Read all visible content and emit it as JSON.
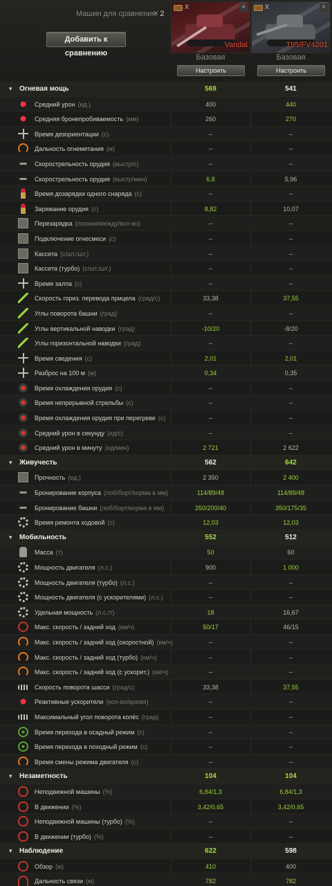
{
  "header": {
    "compare_label": "Машин для сравнения:",
    "compare_count": "2",
    "clear_glyph": "×",
    "add_button": "Добавить к сравнению"
  },
  "vehicles": [
    {
      "name": "Vandal",
      "config": "Базовая",
      "setup": "Настроить",
      "close": "×",
      "mark": "X"
    },
    {
      "name": "T95/FV4201",
      "config": "Базовая",
      "setup": "Настроить",
      "close": "×",
      "mark": "X"
    }
  ],
  "colors": {
    "better": "#9bd43b",
    "name": "#e8533a",
    "bg": "#1b1b19"
  },
  "rows": [
    {
      "type": "section",
      "label": "Огневая мощь",
      "v1": "569",
      "v2": "541",
      "g1": true,
      "g2": false
    },
    {
      "icon": "ic-fire",
      "icon_name": "damage-icon",
      "label": "Средний урон",
      "unit": "(ед.)",
      "v1": "400",
      "v2": "440",
      "g1": false,
      "g2": true
    },
    {
      "icon": "ic-fire",
      "icon_name": "penetration-icon",
      "label": "Средняя бронепробиваемость",
      "unit": "(мм)",
      "v1": "260",
      "v2": "270",
      "g1": false,
      "g2": true
    },
    {
      "icon": "ic-cross",
      "icon_name": "stun-time-icon",
      "label": "Время дезориентации",
      "unit": "(с)",
      "v1": "--",
      "v2": "--"
    },
    {
      "icon": "ic-gauge",
      "icon_name": "flamethrower-range-icon",
      "label": "Дальность огнеметания",
      "unit": "(м)",
      "v1": "--",
      "v2": "--"
    },
    {
      "icon": "ic-gun",
      "icon_name": "fire-rate-icon",
      "label": "Скорострельность орудия",
      "unit": "(выстр/с)",
      "v1": "--",
      "v2": "--"
    },
    {
      "icon": "ic-gun",
      "icon_name": "fire-rate-min-icon",
      "label": "Скорострельность орудия",
      "unit": "(выстр/мин)",
      "v1": "6,8",
      "v2": "5,96",
      "g1": true,
      "g2": false
    },
    {
      "icon": "ic-shell",
      "icon_name": "shell-reload-icon",
      "label": "Время дозарядки одного снаряда",
      "unit": "(с)",
      "v1": "--",
      "v2": "--"
    },
    {
      "icon": "ic-shell",
      "icon_name": "reload-icon",
      "label": "Заряжание орудия",
      "unit": "(с)",
      "v1": "8,82",
      "v2": "10,07",
      "g1": true,
      "g2": false
    },
    {
      "icon": "ic-box",
      "icon_name": "autoreload-icon",
      "label": "Перезарядка",
      "unit": "(полная/между/кол-во)",
      "v1": "--",
      "v2": "--"
    },
    {
      "icon": "ic-box",
      "icon_name": "flame-mix-icon",
      "label": "Подключение огнесмеси",
      "unit": "(с)",
      "v1": "--",
      "v2": "--"
    },
    {
      "icon": "ic-box",
      "icon_name": "clip-icon",
      "label": "Кассета",
      "unit": "(с/шт./шт.)",
      "v1": "--",
      "v2": "--"
    },
    {
      "icon": "ic-box",
      "icon_name": "clip-turbo-icon",
      "label": "Кассета (турбо)",
      "unit": "(с/шт./шт.)",
      "v1": "--",
      "v2": "--"
    },
    {
      "icon": "ic-cross",
      "icon_name": "salvo-time-icon",
      "label": "Время залпа",
      "unit": "(с)",
      "v1": "--",
      "v2": "--"
    },
    {
      "icon": "ic-arrow",
      "icon_name": "traverse-speed-icon",
      "label": "Скорость гориз. перевода прицела",
      "unit": "(град/с)",
      "v1": "33,38",
      "v2": "37,55",
      "g1": false,
      "g2": true
    },
    {
      "icon": "ic-arrow",
      "icon_name": "turret-angles-icon",
      "label": "Углы поворота башни",
      "unit": "(град)",
      "v1": "--",
      "v2": "--"
    },
    {
      "icon": "ic-arrow",
      "icon_name": "vertical-angles-icon",
      "label": "Углы вертикальной наводки",
      "unit": "(град)",
      "v1": "-10/20",
      "v2": "-8/20",
      "g1": true,
      "g2": false
    },
    {
      "icon": "ic-arrow",
      "icon_name": "horizontal-angles-icon",
      "label": "Углы горизонтальной наводки",
      "unit": "(град)",
      "v1": "--",
      "v2": "--"
    },
    {
      "icon": "ic-cross",
      "icon_name": "aim-time-icon",
      "label": "Время сведения",
      "unit": "(с)",
      "v1": "2,01",
      "v2": "2,01",
      "g1": true,
      "g2": true
    },
    {
      "icon": "ic-cross",
      "icon_name": "dispersion-icon",
      "label": "Разброс на 100 м",
      "unit": "(м)",
      "v1": "0,34",
      "v2": "0,35",
      "g1": true,
      "g2": false
    },
    {
      "icon": "ic-dot",
      "icon_name": "gun-cooling-icon",
      "label": "Время охлаждения орудия",
      "unit": "(с)",
      "v1": "--",
      "v2": "--"
    },
    {
      "icon": "ic-dot",
      "icon_name": "continuous-fire-icon",
      "label": "Время непрерывной стрельбы",
      "unit": "(с)",
      "v1": "--",
      "v2": "--"
    },
    {
      "icon": "ic-dot",
      "icon_name": "overheat-cooling-icon",
      "label": "Время охлаждения орудия при перегреве",
      "unit": "(с)",
      "v1": "--",
      "v2": "--"
    },
    {
      "icon": "ic-dot",
      "icon_name": "dps-icon",
      "label": "Средний урон в секунду",
      "unit": "(ед/с)",
      "v1": "--",
      "v2": "--"
    },
    {
      "icon": "ic-dot",
      "icon_name": "dpm-icon",
      "label": "Средний урон в минуту",
      "unit": "(ед/мин)",
      "v1": "2 721",
      "v2": "2 622",
      "g1": true,
      "g2": false
    },
    {
      "type": "section",
      "label": "Живучесть",
      "v1": "562",
      "v2": "642",
      "g1": false,
      "g2": true
    },
    {
      "icon": "ic-box",
      "icon_name": "hitpoints-icon",
      "label": "Прочность",
      "unit": "(ед.)",
      "v1": "2 350",
      "v2": "2 400",
      "g1": false,
      "g2": true
    },
    {
      "icon": "ic-gun",
      "icon_name": "hull-armor-icon",
      "label": "Бронирование корпуса",
      "unit": "(лоб/борт/корма в мм)",
      "v1": "114/89/48",
      "v2": "114/89/48",
      "g1": true,
      "g2": true
    },
    {
      "icon": "ic-gun",
      "icon_name": "turret-armor-icon",
      "label": "Бронирование башни",
      "unit": "(лоб/борт/корма в мм)",
      "v1": "250/200/40",
      "v2": "350/175/35",
      "g1": true,
      "g2": true
    },
    {
      "icon": "ic-gear",
      "icon_name": "repair-time-icon",
      "label": "Время ремонта ходовой",
      "unit": "(с)",
      "v1": "12,03",
      "v2": "12,03",
      "g1": true,
      "g2": true
    },
    {
      "type": "section",
      "label": "Мобильность",
      "v1": "552",
      "v2": "512",
      "g1": true,
      "g2": false
    },
    {
      "icon": "ic-weight",
      "icon_name": "weight-icon",
      "label": "Масса",
      "unit": "(т)",
      "v1": "50",
      "v2": "60",
      "g1": true,
      "g2": false
    },
    {
      "icon": "ic-gear",
      "icon_name": "engine-power-icon",
      "label": "Мощность двигателя",
      "unit": "(л.с.)",
      "v1": "900",
      "v2": "1 000",
      "g1": false,
      "g2": true
    },
    {
      "icon": "ic-gear",
      "icon_name": "engine-turbo-icon",
      "label": "Мощность двигателя (турбо)",
      "unit": "(л.с.)",
      "v1": "--",
      "v2": "--"
    },
    {
      "icon": "ic-gear",
      "icon_name": "engine-boost-icon",
      "label": "Мощность двигателя (с ускорителями)",
      "unit": "(л.с.)",
      "v1": "--",
      "v2": "--"
    },
    {
      "icon": "ic-gear",
      "icon_name": "specific-power-icon",
      "label": "Удельная мощность",
      "unit": "(л.с./т)",
      "v1": "18",
      "v2": "16,67",
      "g1": true,
      "g2": false
    },
    {
      "icon": "ic-circle",
      "icon_name": "max-speed-icon",
      "label": "Макс. скорость / задний ход",
      "unit": "(км/ч)",
      "v1": "50/17",
      "v2": "46/15",
      "g1": true,
      "g2": false
    },
    {
      "icon": "ic-gauge",
      "icon_name": "speed-fast-icon",
      "label": "Макс. скорость / задний ход (скоростной)",
      "unit": "(км/ч)",
      "v1": "--",
      "v2": "--"
    },
    {
      "icon": "ic-gauge",
      "icon_name": "speed-turbo-icon",
      "label": "Макс. скорость / задний ход (турбо)",
      "unit": "(км/ч)",
      "v1": "--",
      "v2": "--"
    },
    {
      "icon": "ic-gauge",
      "icon_name": "speed-boost-icon",
      "label": "Макс. скорость / задний ход (с ускорит.)",
      "unit": "(км/ч)",
      "v1": "--",
      "v2": "--"
    },
    {
      "icon": "ic-track",
      "icon_name": "chassis-rotation-icon",
      "label": "Скорость поворота шасси",
      "unit": "(град/с)",
      "v1": "33,38",
      "v2": "37,55",
      "g1": false,
      "g2": true
    },
    {
      "icon": "ic-fire",
      "icon_name": "jet-boosters-icon",
      "label": "Реактивные ускорители",
      "unit": "(кол-во/время)",
      "v1": "--",
      "v2": "--"
    },
    {
      "icon": "ic-track",
      "icon_name": "wheel-angle-icon",
      "label": "Максимальный угол поворота колёс",
      "unit": "(град)",
      "v1": "--",
      "v2": "--"
    },
    {
      "icon": "ic-green",
      "icon_name": "siege-mode-icon",
      "label": "Время перехода в осадный режим",
      "unit": "(с)",
      "v1": "--",
      "v2": "--"
    },
    {
      "icon": "ic-green",
      "icon_name": "travel-mode-icon",
      "label": "Время перехода в походный режим",
      "unit": "(с)",
      "v1": "--",
      "v2": "--"
    },
    {
      "icon": "ic-gauge",
      "icon_name": "engine-mode-icon",
      "label": "Время смены режима двигателя",
      "unit": "(с)",
      "v1": "--",
      "v2": "--"
    },
    {
      "type": "section",
      "label": "Незаметность",
      "v1": "104",
      "v2": "104",
      "g1": true,
      "g2": true
    },
    {
      "icon": "ic-eye",
      "icon_name": "camo-stationary-icon",
      "label": "Неподвижной машины",
      "unit": "(%)",
      "v1": "6,84/1,3",
      "v2": "6,84/1,3",
      "g1": true,
      "g2": true
    },
    {
      "icon": "ic-eye",
      "icon_name": "camo-moving-icon",
      "label": "В движении",
      "unit": "(%)",
      "v1": "3,42/0,65",
      "v2": "3,42/0,65",
      "g1": true,
      "g2": true
    },
    {
      "icon": "ic-eye",
      "icon_name": "camo-turbo-stationary-icon",
      "label": "Неподвижной машины (турбо)",
      "unit": "(%)",
      "v1": "--",
      "v2": "--"
    },
    {
      "icon": "ic-eye",
      "icon_name": "camo-turbo-moving-icon",
      "label": "В движении (турбо)",
      "unit": "(%)",
      "v1": "--",
      "v2": "--"
    },
    {
      "type": "section",
      "label": "Наблюдение",
      "v1": "622",
      "v2": "598",
      "g1": true,
      "g2": false
    },
    {
      "icon": "ic-eye",
      "icon_name": "view-range-icon",
      "label": "Обзор",
      "unit": "(м)",
      "v1": "410",
      "v2": "400",
      "g1": true,
      "g2": false
    },
    {
      "icon": "ic-radio",
      "icon_name": "radio-range-icon",
      "label": "Дальность связи",
      "unit": "(м)",
      "v1": "782",
      "v2": "782",
      "g1": true,
      "g2": true
    }
  ]
}
